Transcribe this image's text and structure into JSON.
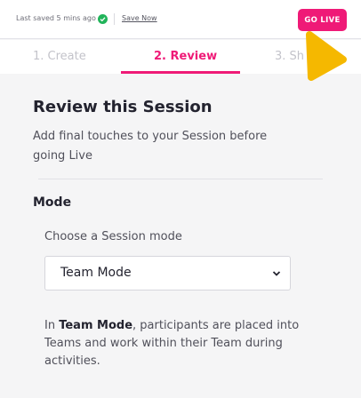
{
  "header": {
    "saved_status": "Last saved 5 mins ago",
    "save_now_label": "Save Now",
    "go_live_label": "GO LIVE"
  },
  "tabs": [
    {
      "label": "1. Create",
      "active": false
    },
    {
      "label": "2. Review",
      "active": true
    },
    {
      "label": "3. Sh",
      "active": false
    }
  ],
  "main": {
    "title": "Review this Session",
    "subtitle": "Add final touches to your Session before going Live",
    "mode_section_title": "Mode",
    "mode_select_label": "Choose a Session mode",
    "mode_select_value": "Team Mode",
    "mode_description_prefix": "In ",
    "mode_description_bold": "Team Mode",
    "mode_description_rest": ", participants are placed into Teams and work within their Team during activities."
  },
  "colors": {
    "accent": "#ef1a77",
    "success": "#21b45a",
    "cursor": "#f5b800"
  },
  "icons": {
    "saved": "check-circle-icon",
    "select": "chevron-down-icon",
    "pointer": "cursor-arrow-icon"
  }
}
